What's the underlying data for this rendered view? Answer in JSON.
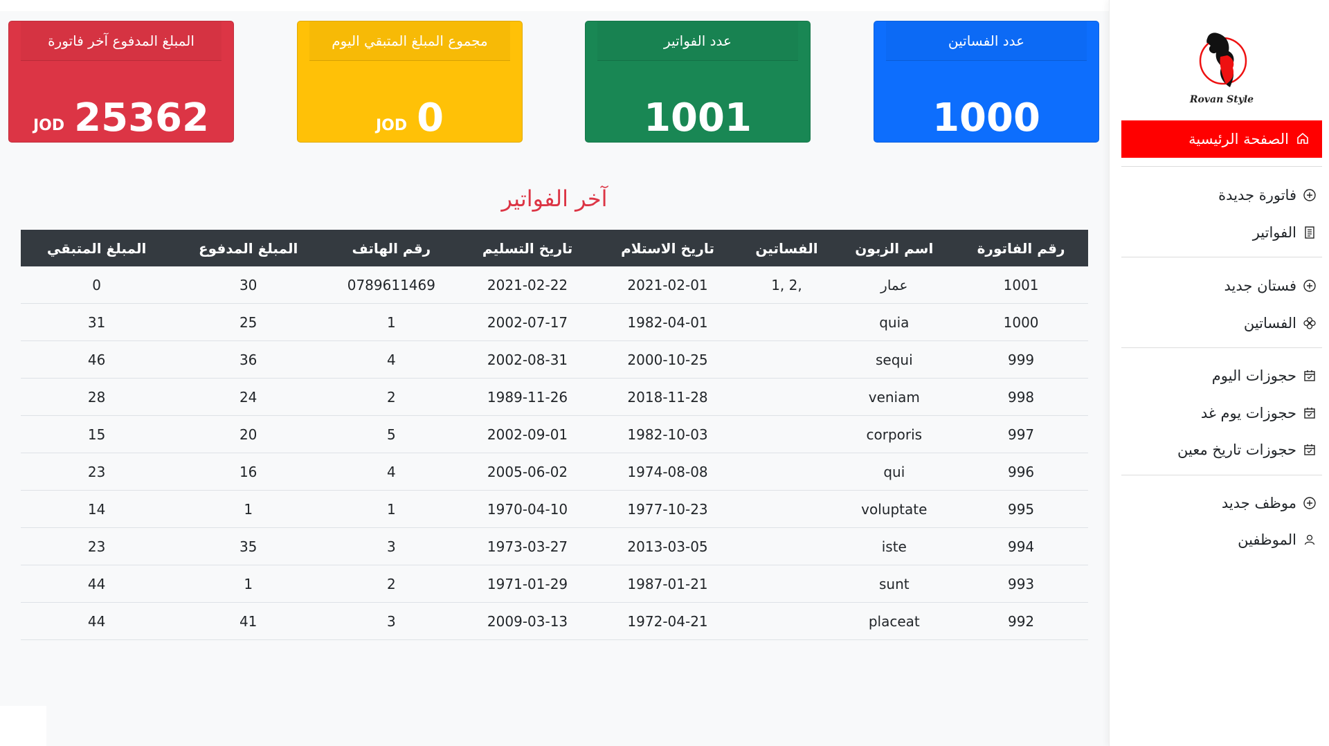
{
  "brand": {
    "logo_text": "Rovan Style",
    "accent": "#ff0000"
  },
  "sidebar": {
    "home": {
      "label": "الصفحة الرئيسية",
      "icon": "home-icon"
    },
    "groups": [
      [
        {
          "label": "فاتورة جديدة",
          "icon": "plus-circle-icon"
        },
        {
          "label": "الفواتير",
          "icon": "receipt-icon"
        }
      ],
      [
        {
          "label": "فستان جديد",
          "icon": "plus-circle-icon"
        },
        {
          "label": "الفساتين",
          "icon": "flower-icon"
        }
      ],
      [
        {
          "label": "حجوزات اليوم",
          "icon": "calendar-check-icon"
        },
        {
          "label": "حجوزات يوم غد",
          "icon": "calendar-check-icon"
        },
        {
          "label": "حجوزات تاريخ معين",
          "icon": "calendar-check-icon"
        }
      ],
      [
        {
          "label": "موظف جديد",
          "icon": "plus-circle-icon"
        },
        {
          "label": "الموظفين",
          "icon": "person-icon"
        }
      ]
    ]
  },
  "cards": [
    {
      "title": "عدد الفساتين",
      "value": "1000",
      "currency": "",
      "color": "#0d6efd"
    },
    {
      "title": "عدد الفواتير",
      "value": "1001",
      "currency": "",
      "color": "#198754"
    },
    {
      "title": "مجموع المبلغ المتبقي اليوم",
      "value": "0",
      "currency": "JOD",
      "color": "#ffc107"
    },
    {
      "title": "المبلغ المدفوع آخر فاتورة",
      "value": "25362",
      "currency": "JOD",
      "color": "#dc3545"
    }
  ],
  "table": {
    "title": "آخر الفواتير",
    "columns": [
      "رقم الفاتورة",
      "اسم الزبون",
      "الفساتين",
      "تاريخ الاستلام",
      "تاريخ التسليم",
      "رقم الهاتف",
      "المبلغ المدفوع",
      "المبلغ المتبقي"
    ],
    "rows": [
      [
        "1001",
        "عمار",
        "1, 2,",
        "2021-02-01",
        "2021-02-22",
        "0789611469",
        "30",
        "0"
      ],
      [
        "1000",
        "quia",
        "",
        "1982-04-01",
        "2002-07-17",
        "1",
        "25",
        "31"
      ],
      [
        "999",
        "sequi",
        "",
        "2000-10-25",
        "2002-08-31",
        "4",
        "36",
        "46"
      ],
      [
        "998",
        "veniam",
        "",
        "2018-11-28",
        "1989-11-26",
        "2",
        "24",
        "28"
      ],
      [
        "997",
        "corporis",
        "",
        "1982-10-03",
        "2002-09-01",
        "5",
        "20",
        "15"
      ],
      [
        "996",
        "qui",
        "",
        "1974-08-08",
        "2005-06-02",
        "4",
        "16",
        "23"
      ],
      [
        "995",
        "voluptate",
        "",
        "1977-10-23",
        "1970-04-10",
        "1",
        "1",
        "14"
      ],
      [
        "994",
        "iste",
        "",
        "2013-03-05",
        "1973-03-27",
        "3",
        "35",
        "23"
      ],
      [
        "993",
        "sunt",
        "",
        "1987-01-21",
        "1971-01-29",
        "2",
        "1",
        "44"
      ],
      [
        "992",
        "placeat",
        "",
        "1972-04-21",
        "2009-03-13",
        "3",
        "41",
        "44"
      ]
    ]
  }
}
